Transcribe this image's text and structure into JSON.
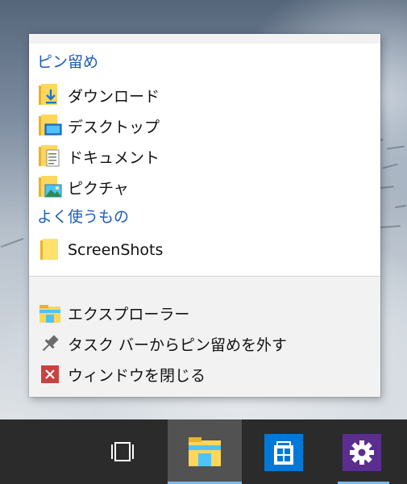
{
  "jumplist": {
    "pinned_header": "ピン留め",
    "pinned_items": [
      {
        "label": "ダウンロード",
        "icon": "downloads-folder-icon"
      },
      {
        "label": "デスクトップ",
        "icon": "desktop-folder-icon"
      },
      {
        "label": "ドキュメント",
        "icon": "documents-folder-icon"
      },
      {
        "label": "ピクチャ",
        "icon": "pictures-folder-icon"
      }
    ],
    "frequent_header": "よく使うもの",
    "frequent_items": [
      {
        "label": "ScreenShots",
        "icon": "folder-icon"
      }
    ],
    "tasks": [
      {
        "label": "エクスプローラー",
        "icon": "file-explorer-icon"
      },
      {
        "label": "タスク バーからピン留めを外す",
        "icon": "pin-icon"
      },
      {
        "label": "ウィンドウを閉じる",
        "icon": "close-icon"
      }
    ]
  },
  "taskbar": {
    "buttons": [
      {
        "name": "task-view",
        "icon": "task-view-icon",
        "active": false
      },
      {
        "name": "file-explorer",
        "icon": "file-explorer-icon",
        "active": true
      },
      {
        "name": "store",
        "icon": "store-icon",
        "active": false
      },
      {
        "name": "settings",
        "icon": "gear-icon",
        "active": false
      }
    ]
  },
  "colors": {
    "header_text": "#1e5db3",
    "taskbar_bg": "#2b2b2b",
    "active_highlight": "#525252",
    "running_indicator": "#76b9ed",
    "store_tile": "#0078d7",
    "settings_tile": "#5c2d91",
    "close_red": "#c8423e"
  }
}
